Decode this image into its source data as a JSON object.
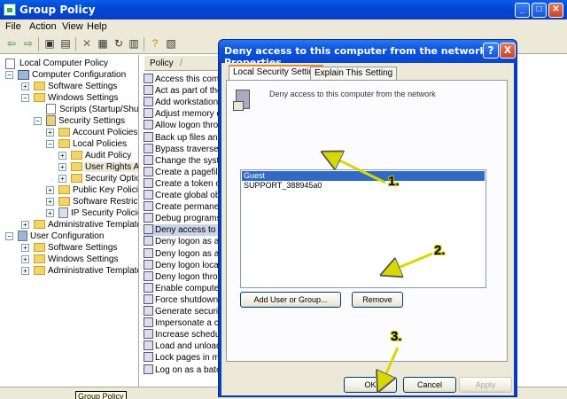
{
  "window": {
    "title": "Group Policy"
  },
  "menu": [
    "File",
    "Action",
    "View",
    "Help"
  ],
  "tree": {
    "root": "Local Computer Policy",
    "items": [
      "Computer Configuration",
      "Software Settings",
      "Windows Settings",
      "Scripts (Startup/Shutdc",
      "Security Settings",
      "Account Policies",
      "Local Policies",
      "Audit Policy",
      "User Rights As",
      "Security Option",
      "Public Key Policies",
      "Software Restrictic",
      "IP Security Policies",
      "Administrative Templates",
      "User Configuration",
      "Software Settings",
      "Windows Settings",
      "Administrative Templates"
    ]
  },
  "list": {
    "header": "Policy",
    "sort_indicator": "/",
    "items": [
      "Access this compu",
      "Act as part of the",
      "Add workstations t",
      "Adjust memory qu",
      "Allow logon throug",
      "Back up files and d",
      "Bypass traverse c",
      "Change the systen",
      "Create a pagefile",
      "Create a token ob",
      "Create global obje",
      "Create permanent",
      "Debug programs",
      "Deny access to thi",
      "Deny logon as a b",
      "Deny logon as a s",
      "Deny logon locally",
      "Deny logon throug",
      "Enable computer a",
      "Force shutdown fr",
      "Generate security",
      "Impersonate a clie",
      "Increase schedulin",
      "Load and unload d",
      "Lock pages in mem",
      "Log on as a batch"
    ]
  },
  "tooltip": "Group Policy",
  "dialog": {
    "title": "Deny access to this computer from the network Properties",
    "help_button": "?",
    "close_button": "X",
    "tabs": [
      "Local Security Setting",
      "Explain This Setting"
    ],
    "description": "Deny access to this computer from the network",
    "accounts": [
      "Guest",
      "SUPPORT_388945a0"
    ],
    "add_button": "Add User or Group...",
    "remove_button": "Remove",
    "ok_button": "OK",
    "cancel_button": "Cancel",
    "apply_button": "Apply"
  },
  "annotations": [
    "1.",
    "2.",
    "3."
  ],
  "colors": {
    "titlebar": "#0a46d5",
    "selection": "#316ac5",
    "annotation_arrow": "#d8d800",
    "dialog_face": "#ece9d8"
  }
}
